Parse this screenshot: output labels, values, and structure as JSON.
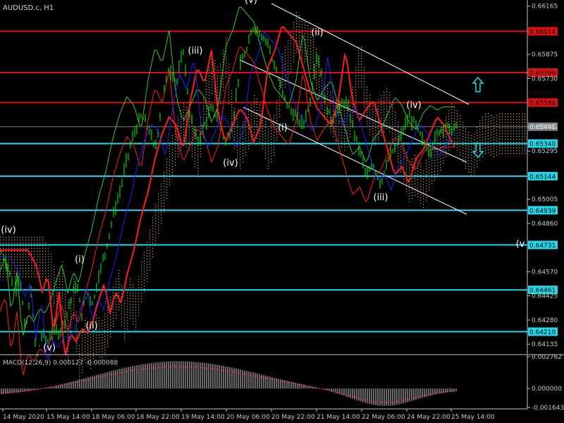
{
  "header": {
    "symbol_label": "AUDUSD.c, H1"
  },
  "chart_data": {
    "type": "candlestick",
    "title": "AUDUSD.c, H1",
    "price_axis": {
      "range": [
        0.64085,
        0.66185
      ],
      "ticks": [
        "0.66165",
        "0.65875",
        "0.65730",
        "0.65441",
        "0.65295",
        "0.65005",
        "0.64860",
        "0.64570",
        "0.64425",
        "0.64280",
        "0.64135"
      ]
    },
    "time_axis": {
      "labels": [
        "14 May 2020",
        "15 May 14:00",
        "18 May 06:00",
        "18 May 22:00",
        "19 May 14:00",
        "20 May 06:00",
        "20 May 22:00",
        "21 May 14:00",
        "22 May 06:00",
        "24 May 22:00",
        "25 May 14:00"
      ]
    },
    "horizontal_levels": [
      {
        "value": 0.66014,
        "label": "0.66014",
        "color": "#e01010"
      },
      {
        "value": 0.65766,
        "label": "0.65766",
        "color": "#e01010"
      },
      {
        "value": 0.65586,
        "label": "0.65586",
        "color": "#e01010"
      },
      {
        "value": 0.65441,
        "label": "0.65441",
        "color": "#7a8088"
      },
      {
        "value": 0.6534,
        "label": "0.65340",
        "color": "#20d8e8"
      },
      {
        "value": 0.65144,
        "label": "0.65144",
        "color": "#20d8e8"
      },
      {
        "value": 0.64939,
        "label": "0.64939",
        "color": "#20d8e8"
      },
      {
        "value": 0.64731,
        "label": "0.64731",
        "color": "#20d8e8"
      },
      {
        "value": 0.64461,
        "label": "0.64461",
        "color": "#20d8e8"
      },
      {
        "value": 0.6421,
        "label": "0.64210",
        "color": "#20d8e8"
      }
    ],
    "wave_labels": [
      "(v)",
      "(ii)",
      "(iii)",
      "(iv)",
      "(i)",
      "(iv)",
      "(iii)",
      "(iv)",
      "(i)",
      "(ii)",
      "(v)",
      "(iv)",
      "(v"
    ],
    "price_series_anchor": [
      [
        0,
        0.647
      ],
      [
        12,
        0.646
      ],
      [
        20,
        0.6445
      ],
      [
        28,
        0.6455
      ],
      [
        36,
        0.642
      ],
      [
        44,
        0.6445
      ],
      [
        52,
        0.6405
      ],
      [
        60,
        0.642
      ],
      [
        68,
        0.6415
      ],
      [
        76,
        0.6423
      ],
      [
        84,
        0.642
      ],
      [
        92,
        0.6428
      ],
      [
        100,
        0.644
      ],
      [
        108,
        0.645
      ],
      [
        116,
        0.6432
      ],
      [
        124,
        0.6445
      ],
      [
        132,
        0.6438
      ],
      [
        140,
        0.6455
      ],
      [
        150,
        0.647
      ],
      [
        160,
        0.649
      ],
      [
        170,
        0.6505
      ],
      [
        180,
        0.6525
      ],
      [
        190,
        0.654
      ],
      [
        200,
        0.655
      ],
      [
        210,
        0.6545
      ],
      [
        220,
        0.653
      ],
      [
        230,
        0.656
      ],
      [
        240,
        0.658
      ],
      [
        250,
        0.657
      ],
      [
        260,
        0.659
      ],
      [
        270,
        0.655
      ],
      [
        280,
        0.6535
      ],
      [
        290,
        0.6545
      ],
      [
        300,
        0.6555
      ],
      [
        310,
        0.655
      ],
      [
        320,
        0.6535
      ],
      [
        330,
        0.6545
      ],
      [
        340,
        0.658
      ],
      [
        350,
        0.659
      ],
      [
        360,
        0.6605
      ],
      [
        370,
        0.66
      ],
      [
        380,
        0.6595
      ],
      [
        390,
        0.658
      ],
      [
        400,
        0.6565
      ],
      [
        410,
        0.6555
      ],
      [
        420,
        0.655
      ],
      [
        430,
        0.6545
      ],
      [
        440,
        0.656
      ],
      [
        450,
        0.659
      ],
      [
        460,
        0.656
      ],
      [
        470,
        0.6548
      ],
      [
        480,
        0.6555
      ],
      [
        490,
        0.656
      ],
      [
        500,
        0.6545
      ],
      [
        510,
        0.653
      ],
      [
        520,
        0.6515
      ],
      [
        530,
        0.652
      ],
      [
        540,
        0.651
      ],
      [
        550,
        0.6525
      ],
      [
        560,
        0.653
      ],
      [
        570,
        0.654
      ],
      [
        580,
        0.655
      ],
      [
        590,
        0.6545
      ],
      [
        600,
        0.6535
      ],
      [
        610,
        0.653
      ],
      [
        620,
        0.654
      ],
      [
        630,
        0.6545
      ],
      [
        640,
        0.6542
      ],
      [
        648,
        0.6544
      ]
    ],
    "indicator": {
      "name": "MACD(12,26,9) 0.000127 -0.000088",
      "ticks": [
        "0.002762",
        "0.000000",
        "-0.001643"
      ],
      "range": [
        -0.001643,
        0.002762
      ]
    },
    "legend": "none",
    "grid": false
  },
  "colors": {
    "background": "#000000",
    "axis": "#c8c8c8",
    "candle_up": "#00ff00",
    "candle_down": "#00ff00",
    "ma_red": "#ff1c1c",
    "envelope_green": "#32c832",
    "line_blue": "#2020ff",
    "cloud": "#d8a878",
    "trend_white": "#ffffff",
    "arrow_cyan": "#20d8e8",
    "macd_hist": "#d0d0d0",
    "macd_signal": "#ff3030"
  }
}
